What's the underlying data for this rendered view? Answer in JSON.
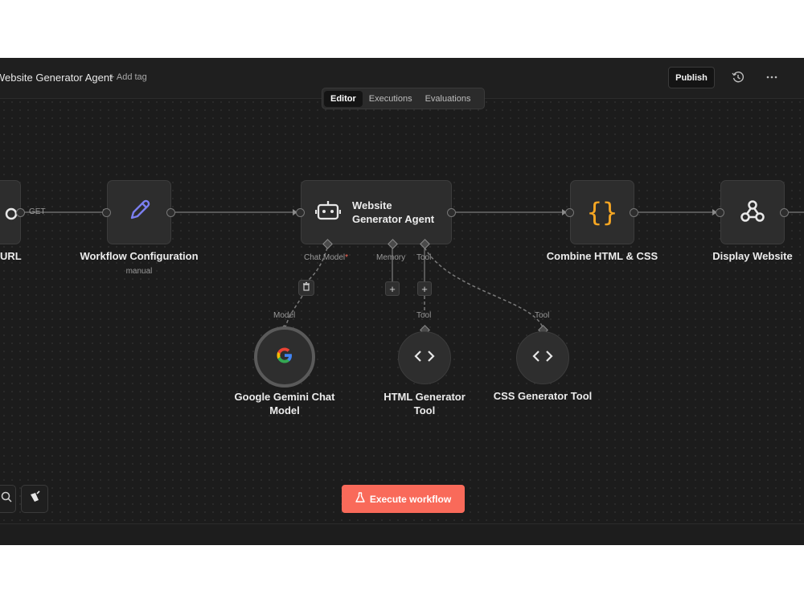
{
  "header": {
    "workflow_title": "Website Generator Agent",
    "add_tag": "+ Add tag",
    "publish_label": "Publish",
    "history_icon": "history-icon",
    "more_icon": "more-horizontal-icon"
  },
  "tabs": [
    {
      "label": "Editor",
      "active": true
    },
    {
      "label": "Executions",
      "active": false
    },
    {
      "label": "Evaluations",
      "active": false
    }
  ],
  "nodes": {
    "url_node": {
      "label": "URL",
      "icon": "webhook-icon"
    },
    "get_label": "GET",
    "workflow_config": {
      "label": "Workflow Configuration",
      "sublabel": "manual",
      "icon": "pencil-icon"
    },
    "agent": {
      "label_line1": "Website",
      "label_line2": "Generator Agent",
      "icon": "robot-icon",
      "ports": {
        "chat_model": "Chat Model",
        "required_mark": "*",
        "memory": "Memory",
        "tool": "Tool"
      }
    },
    "combine": {
      "label": "Combine HTML & CSS",
      "icon": "code-braces-icon"
    },
    "display": {
      "label": "Display Website",
      "icon": "webhook-icon"
    },
    "gemini": {
      "label_line1": "Google Gemini Chat",
      "label_line2": "Model",
      "connector": "Model",
      "icon": "google-icon"
    },
    "html_tool": {
      "label_line1": "HTML Generator",
      "label_line2": "Tool",
      "connector": "Tool",
      "icon": "code-icon"
    },
    "css_tool": {
      "label": "CSS Generator Tool",
      "connector": "Tool",
      "icon": "code-icon"
    }
  },
  "canvas": {
    "execute_label": "Execute workflow",
    "zoom_icon": "zoom-icon",
    "tidy_icon": "broom-icon"
  },
  "colors": {
    "accent": "#f96a5a",
    "braces": "#f5a623",
    "pencil": "#7b7ff0"
  }
}
